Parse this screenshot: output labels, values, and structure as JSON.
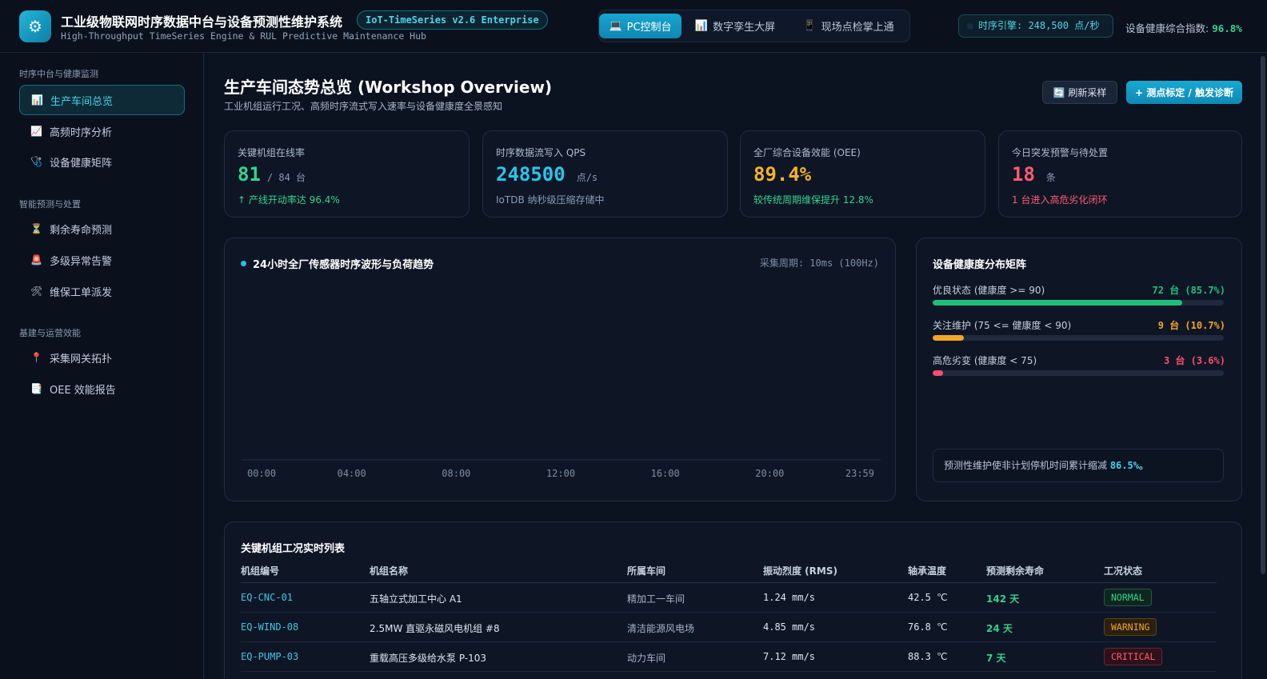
{
  "header": {
    "logo_glyph": "⚙",
    "title": "工业级物联网时序数据中台与设备预测性维护系统",
    "version": "IoT-TimeSeries v2.6 Enterprise",
    "subtitle": "High-Throughput TimeSeries Engine & RUL Predictive Maintenance Hub",
    "modes": [
      {
        "icon": "💻",
        "label": "PC控制台",
        "active": true
      },
      {
        "icon": "📊",
        "label": "数字孪生大屏",
        "active": false
      },
      {
        "icon": "📱",
        "label": "现场点检掌上通",
        "active": false
      }
    ],
    "engine": "时序引擎: 248,500 点/秒",
    "health_index_label": "设备健康综合指数: ",
    "health_index_value": "96.8%"
  },
  "sidebar": {
    "groups": [
      {
        "title": "时序中台与健康监测",
        "items": [
          {
            "icon": "📊",
            "label": "生产车间总览",
            "active": true
          },
          {
            "icon": "📈",
            "label": "高频时序分析"
          },
          {
            "icon": "🩺",
            "label": "设备健康矩阵"
          }
        ]
      },
      {
        "title": "智能预测与处置",
        "items": [
          {
            "icon": "⏳",
            "label": "剩余寿命预测"
          },
          {
            "icon": "🚨",
            "label": "多级异常告警"
          },
          {
            "icon": "🛠",
            "label": "维保工单派发"
          }
        ]
      },
      {
        "title": "基建与运营效能",
        "items": [
          {
            "icon": "📍",
            "label": "采集网关拓扑"
          },
          {
            "icon": "📑",
            "label": "OEE 效能报告"
          }
        ]
      }
    ]
  },
  "main": {
    "title": "生产车间态势总览 (Workshop Overview)",
    "subtitle": "工业机组运行工况、高频时序流式写入速率与设备健康度全景感知",
    "refresh_label": "🔄 刷新采样",
    "calibrate_label": "+ 测点标定 / 触发诊断",
    "kpis": [
      {
        "label": "关键机组在线率",
        "value": "81",
        "suffix": "/ 84 台",
        "note": "↑ 产线开动率达 96.4%",
        "color": "#34d38a",
        "note_color": "#34d38a"
      },
      {
        "label": "时序数据流写入 QPS",
        "value": "248500",
        "suffix": "点/s",
        "note": "IoTDB 纳秒级压缩存储中",
        "color": "#2bc4ea",
        "note_color": "#8a9ab0"
      },
      {
        "label": "全厂综合设备效能 (OEE)",
        "value": "89.4%",
        "suffix": "",
        "note": "较传统周期维保提升 12.8%",
        "color": "#f5b12a",
        "note_color": "#34d38a"
      },
      {
        "label": "今日突发预警与待处置",
        "value": "18",
        "suffix": "条",
        "note": "1 台进入高危劣化闭环",
        "color": "#ff5a6e",
        "note_color": "#ff5a6e"
      }
    ]
  },
  "chart": {
    "title": "24小时全厂传感器时序波形与负荷趋势",
    "period": "采集周期: 10ms (100Hz)"
  },
  "chart_data": {
    "type": "line",
    "title": "24小时全厂传感器时序波形与负荷趋势",
    "categories": [
      "00:00",
      "04:00",
      "08:00",
      "12:00",
      "16:00",
      "20:00",
      "23:59"
    ],
    "series": [],
    "xlabel": "",
    "ylabel": "",
    "grid": false
  },
  "health": {
    "title": "设备健康度分布矩阵",
    "rows": [
      {
        "label": "优良状态 (健康度 >= 90)",
        "value": "72 台 (85.7%)",
        "fraction": 0.857,
        "color": "#1fbf7a"
      },
      {
        "label": "关注维护 (75 <= 健康度 < 90)",
        "value": "9 台 (10.7%)",
        "fraction": 0.107,
        "color": "#f5a524"
      },
      {
        "label": "高危劣变 (健康度 < 75)",
        "value": "3 台 (3.6%)",
        "fraction": 0.036,
        "color": "#ff4d6a"
      }
    ],
    "note_prefix": "预测性维护使非计划停机时间累计缩减 ",
    "note_value": "86.5%。"
  },
  "table": {
    "title": "关键机组工况实时列表",
    "headers": [
      "机组编号",
      "机组名称",
      "所属车间",
      "振动烈度 (RMS)",
      "轴承温度",
      "预测剩余寿命",
      "工况状态"
    ],
    "rows": [
      {
        "id": "EQ-CNC-01",
        "name": "五轴立式加工中心 A1",
        "workshop": "精加工一车间",
        "rms": "1.24 mm/s",
        "temp": "42.5 ℃",
        "rul": "142 天",
        "rul_color": "#34d38a",
        "status": "NORMAL",
        "status_color": "#34d38a"
      },
      {
        "id": "EQ-WIND-08",
        "name": "2.5MW 直驱永磁风电机组 #8",
        "workshop": "清洁能源风电场",
        "rms": "4.85 mm/s",
        "temp": "76.8 ℃",
        "rul": "24 天",
        "rul_color": "#34d38a",
        "status": "WARNING",
        "status_color": "#f5a524"
      },
      {
        "id": "EQ-PUMP-03",
        "name": "重载高压多级给水泵 P-103",
        "workshop": "动力车间",
        "rms": "7.12 mm/s",
        "temp": "88.3 ℃",
        "rul": "7 天",
        "rul_color": "#34d38a",
        "status": "CRITICAL",
        "status_color": "#ff5a6e"
      }
    ]
  }
}
